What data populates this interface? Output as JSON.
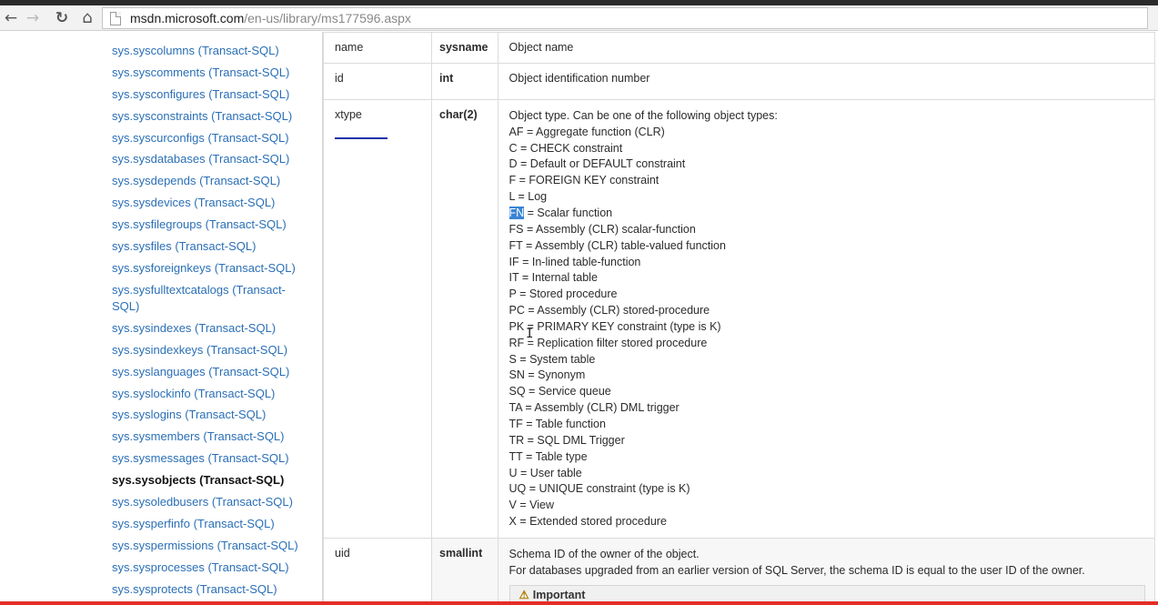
{
  "browser": {
    "url_domain": "msdn.microsoft.com",
    "url_path": "/en-us/library/ms177596.aspx",
    "back_icon": "arrow-left",
    "forward_icon": "arrow-right",
    "reload_icon": "reload",
    "home_icon": "home"
  },
  "leftnav": {
    "items": [
      "sys.syscolumns (Transact-SQL)",
      "sys.syscomments (Transact-SQL)",
      "sys.sysconfigures (Transact-SQL)",
      "sys.sysconstraints (Transact-SQL)",
      "sys.syscurconfigs (Transact-SQL)",
      "sys.sysdatabases (Transact-SQL)",
      "sys.sysdepends (Transact-SQL)",
      "sys.sysdevices (Transact-SQL)",
      "sys.sysfilegroups (Transact-SQL)",
      "sys.sysfiles (Transact-SQL)",
      "sys.sysforeignkeys (Transact-SQL)",
      "sys.sysfulltextcatalogs (Transact-",
      "SQL)",
      "sys.sysindexes (Transact-SQL)",
      "sys.sysindexkeys (Transact-SQL)",
      "sys.syslanguages (Transact-SQL)",
      "sys.syslockinfo (Transact-SQL)",
      "sys.syslogins (Transact-SQL)",
      "sys.sysmembers (Transact-SQL)",
      "sys.sysmessages (Transact-SQL)",
      "sys.sysobjects (Transact-SQL)",
      "sys.sysoledbusers (Transact-SQL)",
      "sys.sysperfinfo (Transact-SQL)",
      "sys.syspermissions (Transact-SQL)",
      "sys.sysprocesses (Transact-SQL)",
      "sys.sysprotects (Transact-SQL)"
    ]
  },
  "table": {
    "rows": [
      {
        "column": "name",
        "type": "sysname",
        "description": "Object name"
      },
      {
        "column": "id",
        "type": "int",
        "description": "Object identification number"
      },
      {
        "column": "xtype",
        "type": "char(2)",
        "description": "Object type. Can be one of the following object types:"
      },
      {
        "column": "uid",
        "type": "smallint",
        "description": "Schema ID of the owner of the object.",
        "description2": "For databases upgraded from an earlier version of SQL Server, the schema ID is equal to the user ID of the owner.",
        "note_label": "Important"
      }
    ],
    "object_types": [
      "AF = Aggregate function (CLR)",
      "C = CHECK constraint",
      "D = Default or DEFAULT constraint",
      "F = FOREIGN KEY constraint",
      "L = Log",
      "FN = Scalar function",
      "FS = Assembly (CLR) scalar-function",
      "FT = Assembly (CLR) table-valued function",
      "IF = In-lined table-function",
      "IT = Internal table",
      "P = Stored procedure",
      "PC = Assembly (CLR) stored-procedure",
      "PK = PRIMARY KEY constraint (type is K)",
      "RF = Replication filter stored procedure",
      "S = System table",
      "SN = Synonym",
      "SQ = Service queue",
      "TA = Assembly (CLR) DML trigger",
      "TF = Table function",
      "TR = SQL DML Trigger",
      "TT = Table type",
      "U = User table",
      "UQ = UNIQUE constraint (type is K)",
      "V = View",
      "X = Extended stored procedure"
    ],
    "selected_text": "FN",
    "selected_rest": " = Scalar function"
  },
  "colors": {
    "link": "#2a6fb6",
    "selection": "#3a84d6",
    "progress_bar": "#e52d27"
  }
}
